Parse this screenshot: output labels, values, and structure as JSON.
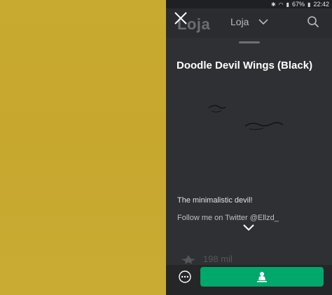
{
  "statusbar": {
    "battery": "67%",
    "time": "22:42"
  },
  "header": {
    "logo": "Loja",
    "dropdown_label": "Loja"
  },
  "item": {
    "title": "Doodle Devil Wings (Black)",
    "description_line1": "The minimalistic devil!",
    "description_line2": "Follow me on Twitter @Ellzd_",
    "favorites": "198 mil"
  },
  "colors": {
    "background_left": "#c9aa30",
    "panel": "#2f3033",
    "buy_button": "#00a86b"
  },
  "icons": {
    "close": "close-icon",
    "dropdown": "chevron-down-icon",
    "search": "search-icon",
    "expand": "chevron-down-icon",
    "favorite": "star-icon",
    "more": "more-options-icon",
    "buy": "avatar-try-on-icon"
  }
}
